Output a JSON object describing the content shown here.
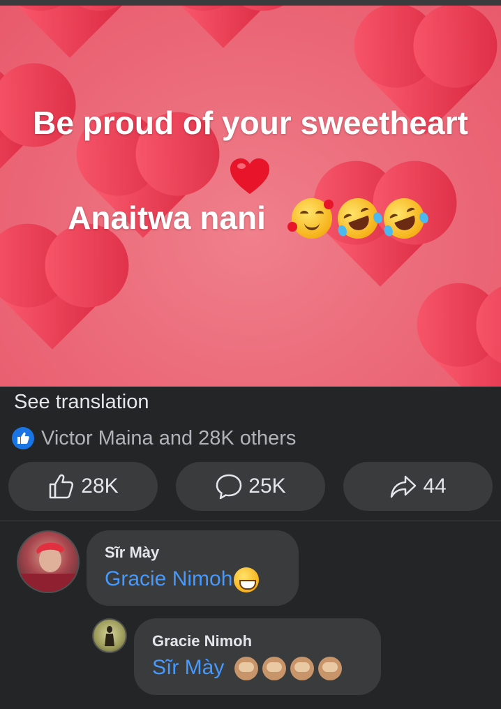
{
  "post": {
    "image_line1": "Be proud of your sweetheart",
    "image_line2": "Anaitwa nani",
    "see_translation": "See translation",
    "reactions_text": "Victor Maina and 28K others"
  },
  "actions": {
    "like_count": "28K",
    "comment_count": "25K",
    "share_count": "44"
  },
  "comments": [
    {
      "author": "Sĩr Mày",
      "text": "Gracie Nimoh"
    },
    {
      "author": "Gracie Nimoh",
      "text": "Sĩr Mày"
    }
  ],
  "colors": {
    "background": "#242526",
    "button": "#3a3b3c",
    "link": "#4599ff",
    "like_blue": "#1b74e4"
  }
}
